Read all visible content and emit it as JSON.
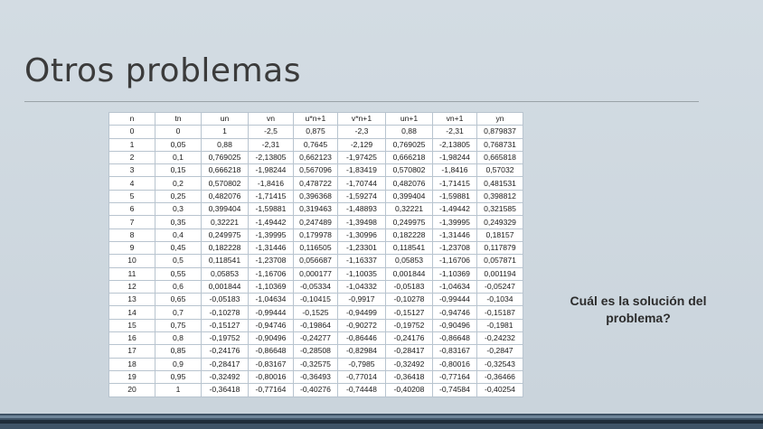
{
  "slide": {
    "title": "Otros problemas",
    "question": "Cuál es la solución del problema?"
  },
  "table": {
    "headers": [
      "n",
      "tn",
      "un",
      "vn",
      "u*n+1",
      "v*n+1",
      "un+1",
      "vn+1",
      "yn"
    ],
    "rows": [
      [
        "0",
        "0",
        "1",
        "-2,5",
        "0,875",
        "-2,3",
        "0,88",
        "-2,31",
        "0,879837"
      ],
      [
        "1",
        "0,05",
        "0,88",
        "-2,31",
        "0,7645",
        "-2,129",
        "0,769025",
        "-2,13805",
        "0,768731"
      ],
      [
        "2",
        "0,1",
        "0,769025",
        "-2,13805",
        "0,662123",
        "-1,97425",
        "0,666218",
        "-1,98244",
        "0,665818"
      ],
      [
        "3",
        "0,15",
        "0,666218",
        "-1,98244",
        "0,567096",
        "-1,83419",
        "0,570802",
        "-1,8416",
        "0,57032"
      ],
      [
        "4",
        "0,2",
        "0,570802",
        "-1,8416",
        "0,478722",
        "-1,70744",
        "0,482076",
        "-1,71415",
        "0,481531"
      ],
      [
        "5",
        "0,25",
        "0,482076",
        "-1,71415",
        "0,396368",
        "-1,59274",
        "0,399404",
        "-1,59881",
        "0,398812"
      ],
      [
        "6",
        "0,3",
        "0,399404",
        "-1,59881",
        "0,319463",
        "-1,48893",
        "0,32221",
        "-1,49442",
        "0,321585"
      ],
      [
        "7",
        "0,35",
        "0,32221",
        "-1,49442",
        "0,247489",
        "-1,39498",
        "0,249975",
        "-1,39995",
        "0,249329"
      ],
      [
        "8",
        "0,4",
        "0,249975",
        "-1,39995",
        "0,179978",
        "-1,30996",
        "0,182228",
        "-1,31446",
        "0,18157"
      ],
      [
        "9",
        "0,45",
        "0,182228",
        "-1,31446",
        "0,116505",
        "-1,23301",
        "0,118541",
        "-1,23708",
        "0,117879"
      ],
      [
        "10",
        "0,5",
        "0,118541",
        "-1,23708",
        "0,056687",
        "-1,16337",
        "0,05853",
        "-1,16706",
        "0,057871"
      ],
      [
        "11",
        "0,55",
        "0,05853",
        "-1,16706",
        "0,000177",
        "-1,10035",
        "0,001844",
        "-1,10369",
        "0,001194"
      ],
      [
        "12",
        "0,6",
        "0,001844",
        "-1,10369",
        "-0,05334",
        "-1,04332",
        "-0,05183",
        "-1,04634",
        "-0,05247"
      ],
      [
        "13",
        "0,65",
        "-0,05183",
        "-1,04634",
        "-0,10415",
        "-0,9917",
        "-0,10278",
        "-0,99444",
        "-0,1034"
      ],
      [
        "14",
        "0,7",
        "-0,10278",
        "-0,99444",
        "-0,1525",
        "-0,94499",
        "-0,15127",
        "-0,94746",
        "-0,15187"
      ],
      [
        "15",
        "0,75",
        "-0,15127",
        "-0,94746",
        "-0,19864",
        "-0,90272",
        "-0,19752",
        "-0,90496",
        "-0,1981"
      ],
      [
        "16",
        "0,8",
        "-0,19752",
        "-0,90496",
        "-0,24277",
        "-0,86446",
        "-0,24176",
        "-0,86648",
        "-0,24232"
      ],
      [
        "17",
        "0,85",
        "-0,24176",
        "-0,86648",
        "-0,28508",
        "-0,82984",
        "-0,28417",
        "-0,83167",
        "-0,2847"
      ],
      [
        "18",
        "0,9",
        "-0,28417",
        "-0,83167",
        "-0,32575",
        "-0,7985",
        "-0,32492",
        "-0,80016",
        "-0,32543"
      ],
      [
        "19",
        "0,95",
        "-0,32492",
        "-0,80016",
        "-0,36493",
        "-0,77014",
        "-0,36418",
        "-0,77164",
        "-0,36466"
      ],
      [
        "20",
        "1",
        "-0,36418",
        "-0,77164",
        "-0,40276",
        "-0,74448",
        "-0,40208",
        "-0,74584",
        "-0,40254"
      ]
    ]
  },
  "colors": {
    "background": "#ccd6de",
    "title": "#3b3b3b",
    "footer": "#3f5366"
  }
}
